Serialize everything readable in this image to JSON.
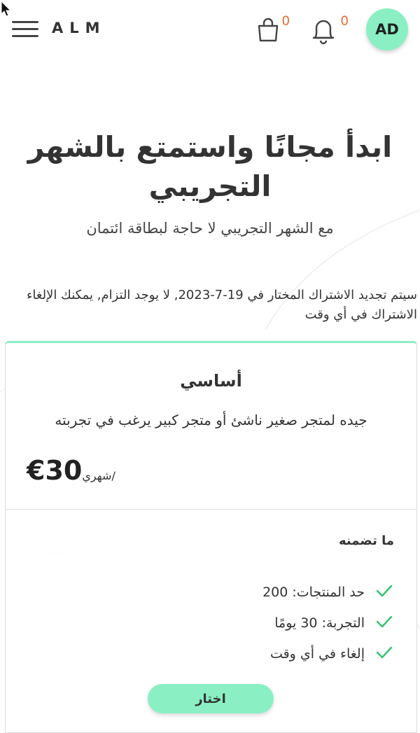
{
  "header": {
    "logo": "ALM",
    "cart_count": "0",
    "notification_count": "0",
    "avatar_initials": "AD"
  },
  "hero": {
    "title": "ابدأ مجانًا واستمتع بالشهر التجريبي",
    "subtitle": "مع الشهر التجريبي لا حاجة لبطاقة ائتمان"
  },
  "renewal_notice": "سيتم تجديد الاشتراك المختار في 19-7-2023, لا يوجد التزام, يمكنك الإلغاء الاشتراك في أي وقت",
  "plan": {
    "name": "أساسي",
    "description": "جيده لمتجر صغير ناشئ أو متجر كبير يرغب في تجربته",
    "price": "€30",
    "period": "/شهري",
    "includes_title": "ما تضمنه",
    "features": [
      "حد المنتجات: 200",
      "التجربة: 30 يومًا",
      "إلغاء في أي وقت"
    ],
    "choose_label": "اختار"
  },
  "colors": {
    "accent": "#8af0c4",
    "badge": "#e8632d",
    "check": "#2fc46e"
  },
  "icons": {
    "menu": "hamburger-icon",
    "cart": "shopping-bag-icon",
    "notifications": "bell-icon",
    "feature": "check-icon"
  }
}
